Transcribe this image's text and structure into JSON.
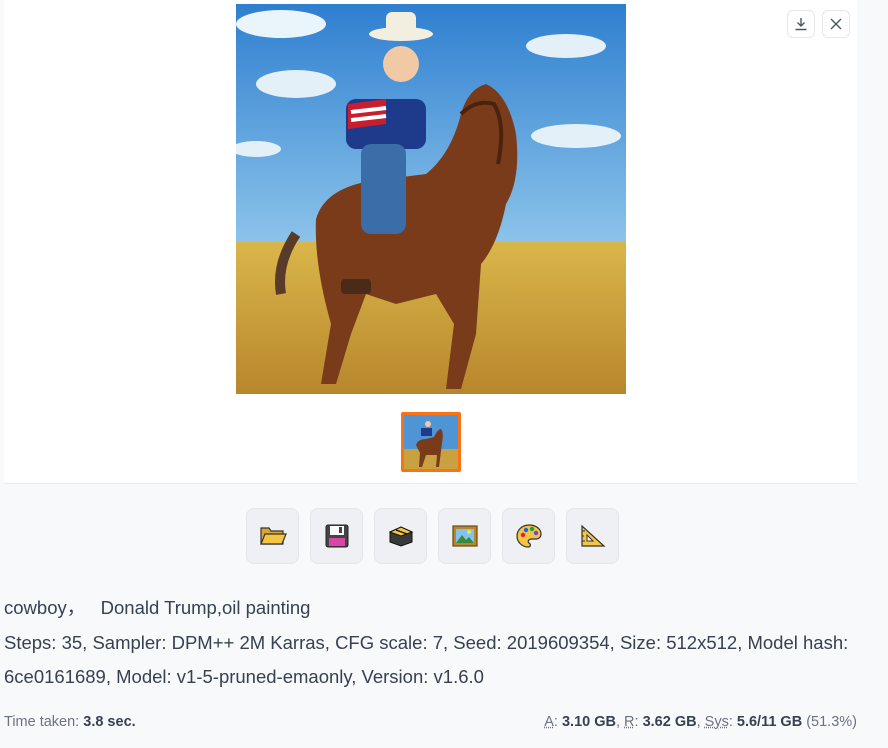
{
  "gallery": {
    "download_icon": "download-icon",
    "close_icon": "close-icon"
  },
  "toolbar": {
    "buttons": [
      {
        "icon": "folder-icon",
        "glyph": "📂"
      },
      {
        "icon": "floppy-disk-icon",
        "glyph": "💾"
      },
      {
        "icon": "zip-archive-icon",
        "glyph": "🗜"
      },
      {
        "icon": "image-frame-icon",
        "glyph": "🖼"
      },
      {
        "icon": "palette-icon",
        "glyph": "🎨"
      },
      {
        "icon": "triangle-ruler-icon",
        "glyph": "📐"
      }
    ]
  },
  "info": {
    "prompt": "cowboy，   Donald Trump,oil painting",
    "params": "Steps: 35, Sampler: DPM++ 2M Karras, CFG scale: 7, Seed: 2019609354, Size: 512x512, Model hash: 6ce0161689, Model: v1-5-pruned-emaonly, Version: v1.6.0"
  },
  "footer": {
    "time_label": "Time taken:",
    "time_value": "3.8 sec.",
    "a_label": "A",
    "a_value": "3.10 GB",
    "r_label": "R",
    "r_value": "3.62 GB",
    "sys_label": "Sys",
    "sys_value": "5.6/11 GB",
    "sys_percent": "(51.3%)"
  },
  "colors": {
    "thumb_border": "#f97316",
    "background": "#f8f9fb"
  }
}
